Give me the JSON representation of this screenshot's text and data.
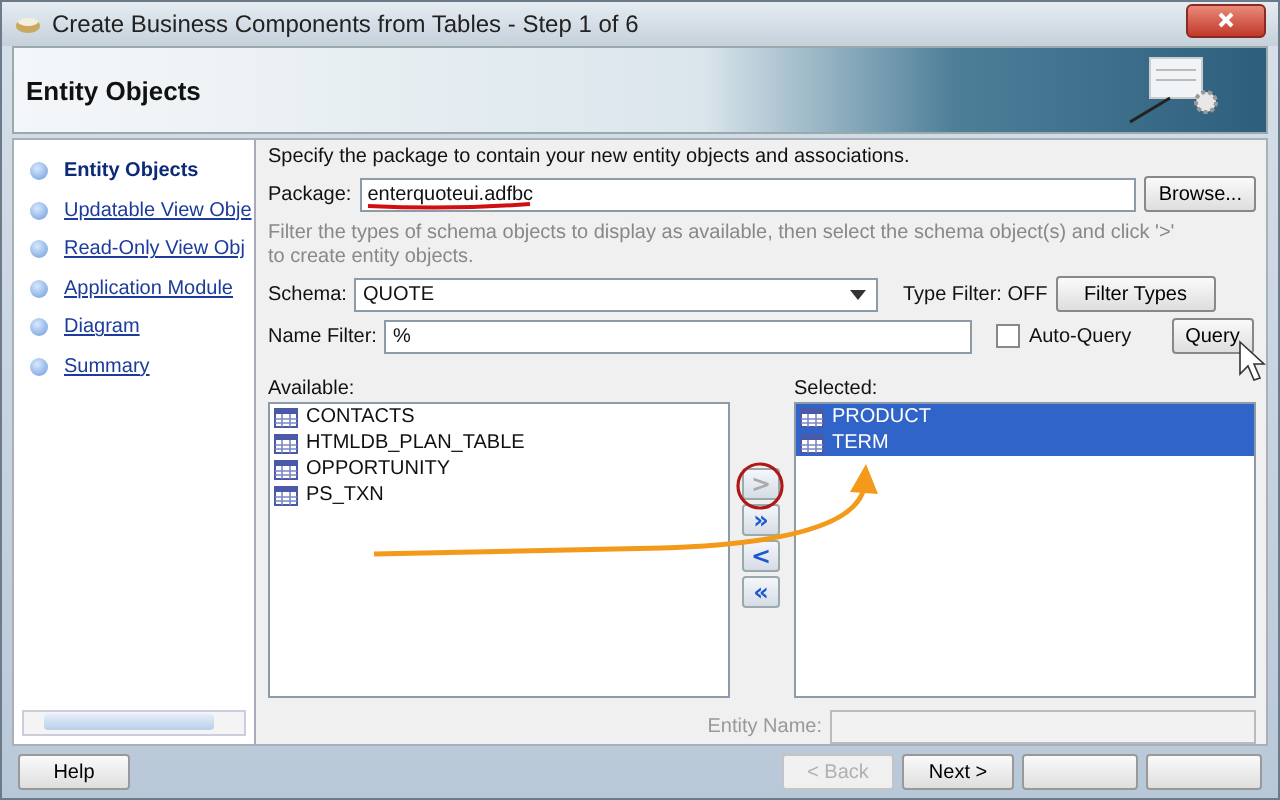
{
  "window": {
    "title": "Create Business Components from Tables - Step 1 of 6"
  },
  "header": {
    "title": "Entity Objects"
  },
  "steps": [
    {
      "label": "Entity Objects",
      "selected": true
    },
    {
      "label": "Updatable View Obje",
      "selected": false
    },
    {
      "label": "Read-Only View Obj",
      "selected": false
    },
    {
      "label": "Application Module",
      "selected": false
    },
    {
      "label": "Diagram",
      "selected": false
    },
    {
      "label": "Summary",
      "selected": false
    }
  ],
  "package_prompt": "Specify the package to contain your new entity objects and associations.",
  "package": {
    "label": "Package:",
    "value": "enterquoteui.adfbc"
  },
  "browse_button": "Browse...",
  "filter_hint": "Filter the types of schema objects to display as available, then select the schema object(s) and click '>' to create entity objects.",
  "schema": {
    "label": "Schema:",
    "value": "QUOTE"
  },
  "type_filter": "Type Filter: OFF",
  "filter_types_button": "Filter Types",
  "name_filter": {
    "label": "Name Filter:",
    "value": "%"
  },
  "auto_query": {
    "label": "Auto-Query",
    "checked": false
  },
  "query_button": "Query",
  "available": {
    "label": "Available:",
    "items": [
      {
        "name": "CONTACTS",
        "selected": false
      },
      {
        "name": "HTMLDB_PLAN_TABLE",
        "selected": false
      },
      {
        "name": "OPPORTUNITY",
        "selected": false
      },
      {
        "name": "PS_TXN",
        "selected": false
      }
    ]
  },
  "selected": {
    "label": "Selected:",
    "items": [
      {
        "name": "PRODUCT",
        "selected": true
      },
      {
        "name": "TERM",
        "selected": true
      }
    ]
  },
  "shuttle_buttons": [
    {
      "label": ">",
      "disabled": true
    },
    {
      "label": "»",
      "disabled": false
    },
    {
      "label": "<",
      "disabled": false
    },
    {
      "label": "«",
      "disabled": false
    }
  ],
  "entity_name": {
    "label": "Entity Name:",
    "disabled": true
  },
  "footer_buttons": [
    {
      "kind": "help",
      "label": "Help"
    },
    {
      "kind": "nav",
      "label": "< Back",
      "disabled": true
    },
    {
      "kind": "nav",
      "label": "Next >",
      "disabled": false
    },
    {
      "kind": "covered"
    },
    {
      "kind": "covered"
    }
  ]
}
